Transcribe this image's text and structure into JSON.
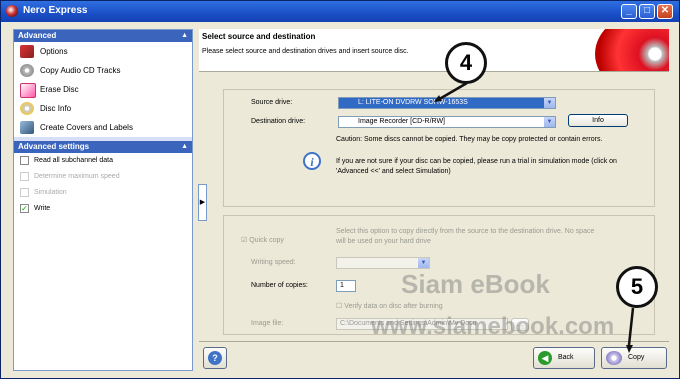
{
  "window": {
    "title": "Nero Express"
  },
  "sidebar": {
    "advanced": {
      "heading": "Advanced",
      "items": [
        {
          "label": "Options"
        },
        {
          "label": "Copy Audio CD Tracks"
        },
        {
          "label": "Erase Disc"
        },
        {
          "label": "Disc Info"
        },
        {
          "label": "Create Covers and Labels"
        }
      ]
    },
    "settings": {
      "heading": "Advanced settings",
      "items": [
        {
          "label": "Read all subchannel data",
          "checked": false,
          "enabled": true
        },
        {
          "label": "Determine maximum speed",
          "checked": false,
          "enabled": false
        },
        {
          "label": "Simulation",
          "checked": false,
          "enabled": false
        },
        {
          "label": "Write",
          "checked": true,
          "enabled": true
        }
      ]
    }
  },
  "header": {
    "title": "Select source and destination",
    "subtitle": "Please select source and destination drives and insert source disc."
  },
  "source": {
    "source_label": "Source drive:",
    "source_value": "L: LITE-ON DVDRW SOHW-1653S",
    "dest_label": "Destination drive:",
    "dest_value": "Image Recorder  [CD-R/RW]",
    "info_button": "Info",
    "caution": "Caution: Some discs cannot be copied. They may be copy protected or contain errors.",
    "tip": "If you are not sure if your disc can be copied, please run a trial in simulation mode (click on 'Advanced <<' and select Simulation)"
  },
  "copy": {
    "quick_copy_label": "Quick copy",
    "quick_copy_checked": true,
    "quick_copy_desc": "Select this option to copy directly from the source to the destination drive. No space will be used on your hard drive",
    "writing_speed_label": "Writing speed:",
    "copies_label": "Number of copies:",
    "copies_value": "1",
    "verify_label": "Verify data on disc after burning",
    "image_file_label": "Image file:",
    "image_file_value": "C:\\Documents and Settings\\Admin\\My Docu"
  },
  "footer": {
    "help_icon": "help-icon",
    "back_label": "Back",
    "copy_label": "Copy"
  },
  "annotations": {
    "callout_4": "4",
    "callout_5": "5",
    "watermark_1": "Siam eBook",
    "watermark_2": "www.siamebook.com"
  },
  "colors": {
    "titlebar": "#1b4fc7",
    "sidebar_header": "#3b65bd",
    "selection": "#316ac5"
  }
}
